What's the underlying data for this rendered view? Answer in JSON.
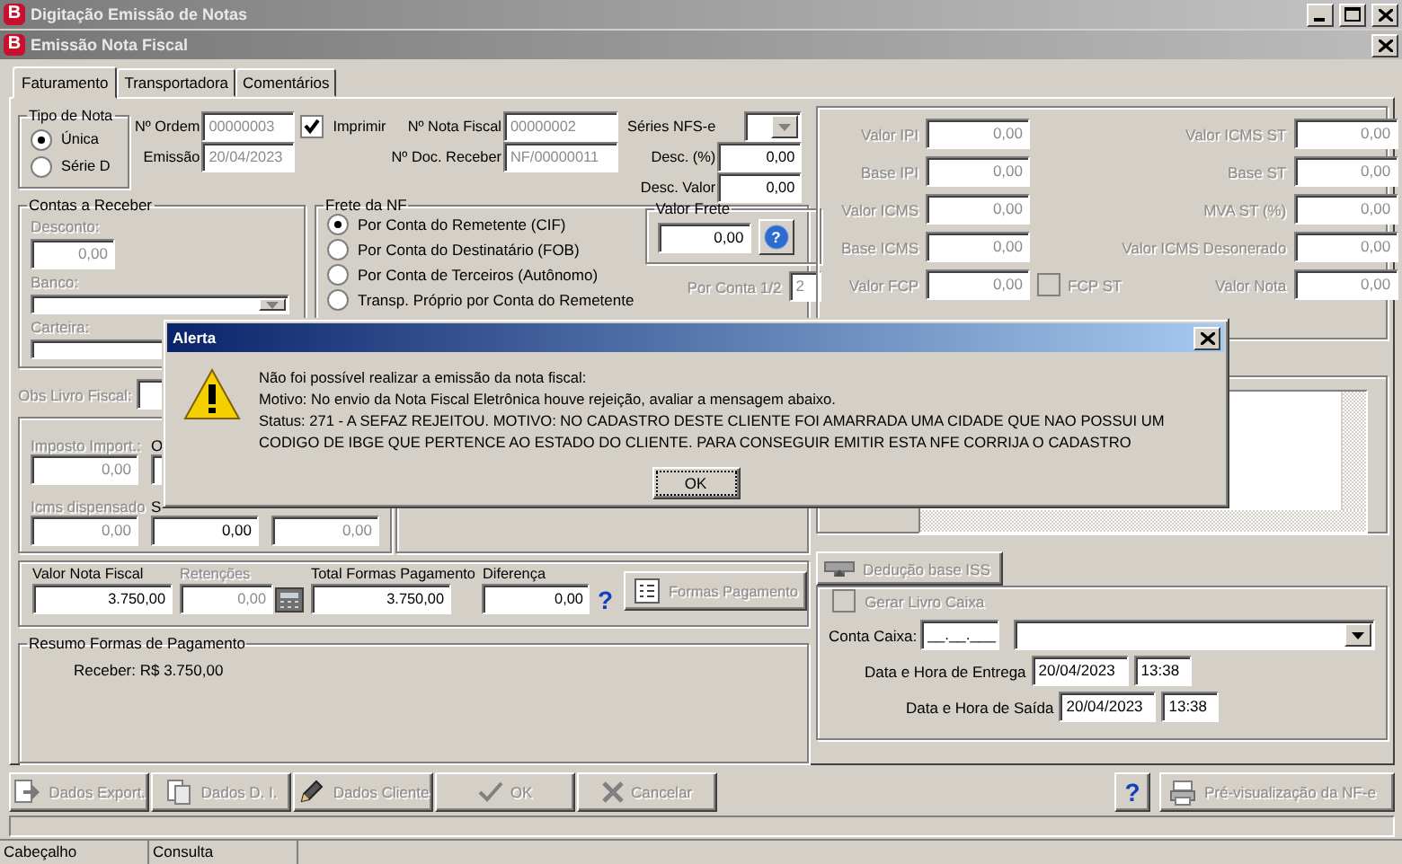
{
  "app_window": {
    "logo": "B",
    "title": "Digitação Emissão de Notas"
  },
  "form_window": {
    "logo": "B",
    "title": "Emissão Nota Fiscal"
  },
  "tabs": [
    {
      "label": "Faturamento",
      "selected": true
    },
    {
      "label": "Transportadora",
      "selected": false
    },
    {
      "label": "Comentários",
      "selected": false
    }
  ],
  "tipo_nota": {
    "title": "Tipo de Nota",
    "options": [
      {
        "label": "Única",
        "selected": true
      },
      {
        "label": "Série D",
        "selected": false
      }
    ]
  },
  "ordem": [
    {
      "label": "Nº Ordem",
      "value": "00000003",
      "disabled": true
    },
    {
      "label": "Emissão",
      "value": "20/04/2023",
      "disabled": true
    }
  ],
  "imprimir": {
    "label": "Imprimir",
    "checked": true
  },
  "nota": [
    {
      "label": "Nº Nota Fiscal",
      "value": "00000002",
      "disabled": true
    },
    {
      "label": "Nº Doc. Receber",
      "value": "NF/00000011",
      "disabled": true
    }
  ],
  "series": {
    "label": "Séries NFS-e",
    "disabled": true
  },
  "descontos": [
    {
      "label": "Desc. (%)",
      "value": "0,00",
      "disabled": false
    },
    {
      "label": "Desc. Valor",
      "value": "0,00",
      "disabled": false
    }
  ],
  "contas": {
    "title": "Contas a Receber",
    "fields": [
      {
        "kind": "edit",
        "label": "Desconto:",
        "value": "0,00",
        "disabled": true
      },
      {
        "kind": "combo",
        "label": "Banco:",
        "disabled": true
      },
      {
        "kind": "edit",
        "label": "Carteira:",
        "disabled": true
      }
    ]
  },
  "frete": {
    "title": "Frete da NF",
    "options": [
      {
        "label": "Por Conta do Remetente (CIF)",
        "selected": true
      },
      {
        "label": "Por Conta do Destinatário (FOB)",
        "selected": false
      },
      {
        "label": "Por Conta de Terceiros (Autônomo)",
        "selected": false
      },
      {
        "label": "Transp. Próprio por Conta do Remetente",
        "selected": false
      }
    ],
    "valor_frete": {
      "title": "Valor Frete",
      "value": "0,00",
      "help": "?"
    },
    "por_conta": {
      "label": "Por Conta 1/2",
      "value": "2",
      "disabled": true
    }
  },
  "obs_livro": {
    "label": "Obs Livro Fiscal:",
    "disabled": true
  },
  "impostos": [
    [
      {
        "label": "Imposto Import.:",
        "value": "0,00",
        "disabled": true
      },
      {
        "label": "O",
        "disabled": false
      }
    ],
    [
      {
        "label": "Icms dispensado",
        "value": "0,00",
        "disabled": true
      },
      {
        "label": "S",
        "value": "0,00",
        "disabled": false
      },
      {
        "value": "0,00",
        "disabled": true
      }
    ]
  ],
  "totais": [
    {
      "kind": "edit",
      "label": "Valor Nota Fiscal",
      "value": "3.750,00",
      "disabled": false
    },
    {
      "kind": "calc",
      "label": "Retenções",
      "value": "0,00",
      "disabled": true
    },
    {
      "kind": "edit",
      "label": "Total Formas Pagamento",
      "value": "3.750,00",
      "disabled": false
    },
    {
      "kind": "help",
      "label": "Diferença",
      "value": "0,00",
      "disabled": false,
      "help": "?"
    }
  ],
  "formas_button": {
    "label": "Formas Pagamento",
    "disabled": true
  },
  "resumo": {
    "title": "Resumo Formas de Pagamento",
    "lines": [
      "Receber: R$ 3.750,00"
    ]
  },
  "tributos": [
    [
      {
        "label": "Valor IPI",
        "value": "0,00",
        "disabled": true
      },
      {
        "label": "Base IPI",
        "value": "0,00",
        "disabled": true
      },
      {
        "label": "Valor ICMS",
        "value": "0,00",
        "disabled": true
      },
      {
        "label": "Base ICMS",
        "value": "0,00",
        "disabled": true
      },
      {
        "label": "Valor FCP",
        "value": "0,00",
        "disabled": true
      }
    ],
    [
      {
        "label": "Valor ICMS ST",
        "value": "0,00",
        "disabled": true
      },
      {
        "label": "Base ST",
        "value": "0,00",
        "disabled": true
      },
      {
        "label": "MVA ST (%)",
        "value": "0,00",
        "disabled": true
      },
      {
        "label": "Valor ICMS Desonerado",
        "value": "0,00",
        "disabled": true
      },
      {
        "label": "Valor Nota",
        "value": "0,00",
        "disabled": true
      }
    ]
  ],
  "fcp_st": {
    "label": "FCP ST",
    "checked": false,
    "disabled": true
  },
  "deducao_button": {
    "label": "Dedução base ISS",
    "disabled": true
  },
  "caixa": {
    "gerar": {
      "label": "Gerar Livro Caixa",
      "checked": false,
      "disabled": true
    },
    "conta": {
      "label": "Conta Caixa:",
      "value": "__.__.___"
    },
    "datas": [
      {
        "label": "Data e Hora de Entrega",
        "date": "20/04/2023",
        "time": "13:38"
      },
      {
        "label": "Data e Hora de Saída",
        "date": "20/04/2023",
        "time": "13:38"
      }
    ]
  },
  "actions": [
    {
      "kind": "export",
      "label": "Dados Export.",
      "disabled": true
    },
    {
      "kind": "di",
      "label": "Dados D. I.",
      "disabled": true
    },
    {
      "kind": "cliente",
      "label": "Dados Cliente",
      "disabled": true
    },
    {
      "kind": "ok",
      "label": "OK",
      "disabled": true
    },
    {
      "kind": "cancel",
      "label": "Cancelar",
      "disabled": true
    }
  ],
  "help_button": {
    "label": "?"
  },
  "preview_button": {
    "label": "Pré-visualização da NF-e",
    "disabled": true
  },
  "status_bar": [
    "Cabeçalho",
    "Consulta"
  ],
  "alert": {
    "title": "Alerta",
    "lines": [
      "Não foi possível realizar a emissão da nota fiscal:",
      "Motivo: No envio da Nota Fiscal Eletrônica houve rejeição, avaliar a mensagem abaixo.",
      "Status: 271 - A SEFAZ REJEITOU. MOTIVO: NO CADASTRO DESTE CLIENTE FOI AMARRADA UMA CIDADE QUE NAO POSSUI UM CODIGO DE IBGE QUE PERTENCE AO ESTADO DO CLIENTE. PARA CONSEGUIR EMITIR ESTA NFE CORRIJA O CADASTRO"
    ],
    "button": "OK"
  }
}
